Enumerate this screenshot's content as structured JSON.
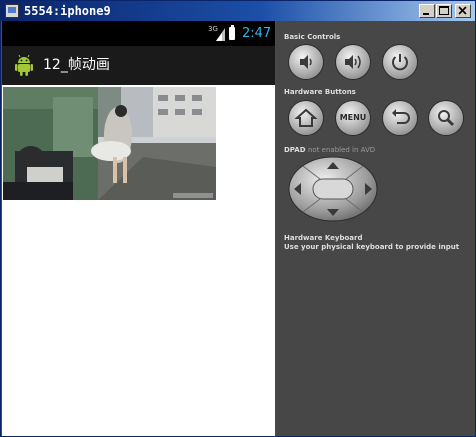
{
  "window": {
    "title": "5554:iphone9"
  },
  "statusbar": {
    "network": "3G",
    "time": "2:47"
  },
  "app": {
    "title": "12_帧动画"
  },
  "panel": {
    "basic_controls": {
      "label": "Basic Controls",
      "buttons": [
        "volume-down",
        "volume-up",
        "power"
      ]
    },
    "hardware_buttons": {
      "label": "Hardware Buttons",
      "menu_label": "MENU",
      "buttons": [
        "home",
        "menu",
        "back",
        "search"
      ]
    },
    "dpad": {
      "label": "DPAD",
      "note": "not enabled in AVD"
    },
    "keyboard": {
      "label": "Hardware Keyboard",
      "hint": "Use your physical keyboard to provide input"
    }
  },
  "colors": {
    "titlebar_start": "#0a246a",
    "titlebar_end": "#a6caf0",
    "clock": "#2fb3ea",
    "panel_bg": "#474747"
  }
}
